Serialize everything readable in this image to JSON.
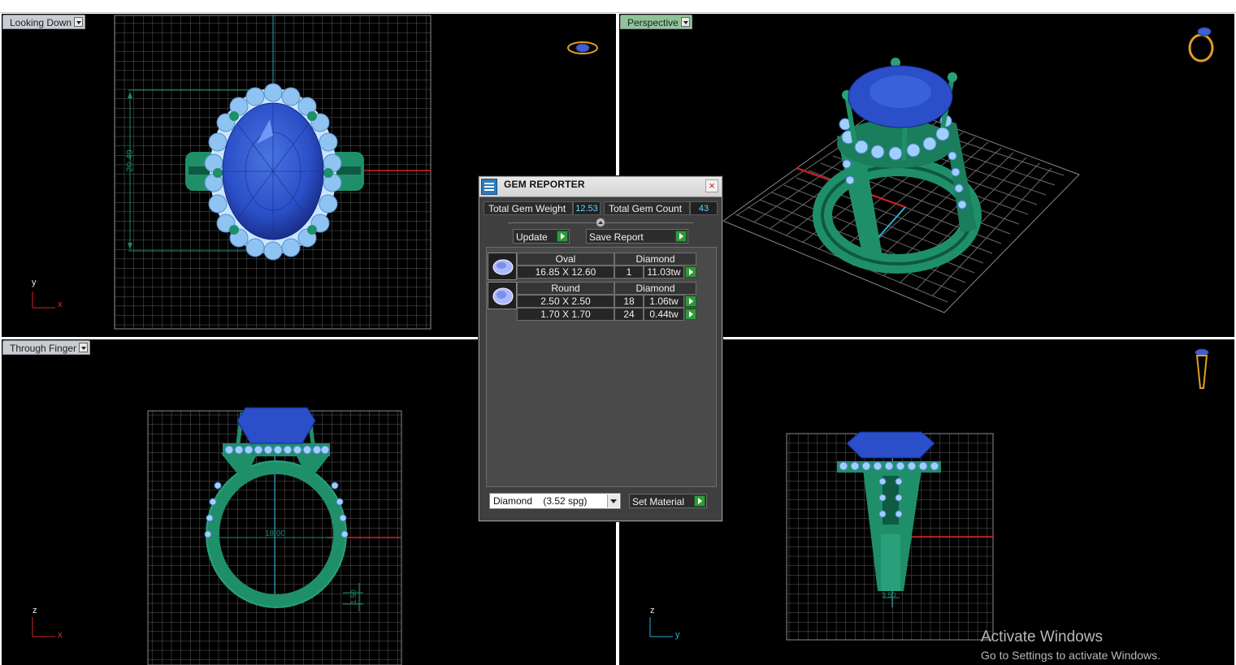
{
  "viewports": {
    "top_left": {
      "label": "Looking Down",
      "dimension": "20.49",
      "axis_v": "y",
      "axis_h": "x"
    },
    "top_right": {
      "label": "Perspective"
    },
    "bottom_left": {
      "label": "Through Finger",
      "dimension": "18.00",
      "dimension2": "1.50",
      "axis_v": "z",
      "axis_h": "x"
    },
    "bottom_right": {
      "dimension": "3.50",
      "axis_v": "z",
      "axis_h": "y"
    }
  },
  "gem_reporter": {
    "title": "GEM REPORTER",
    "close": "×",
    "total_weight_label": "Total Gem Weight",
    "total_weight_value": "12.53",
    "total_count_label": "Total Gem Count",
    "total_count_value": "43",
    "update_label": "Update",
    "save_report_label": "Save Report",
    "groups": [
      {
        "shape": "Oval",
        "material": "Diamond",
        "rows": [
          {
            "size": "16.85 X 12.60",
            "count": "1",
            "weight": "11.03tw"
          }
        ]
      },
      {
        "shape": "Round",
        "material": "Diamond",
        "rows": [
          {
            "size": "2.50 X 2.50",
            "count": "18",
            "weight": "1.06tw"
          },
          {
            "size": "1.70 X 1.70",
            "count": "24",
            "weight": "0.44tw"
          }
        ]
      }
    ],
    "material_select_value": "Diamond    (3.52 spg)",
    "set_material_label": "Set Material"
  },
  "watermark": {
    "title": "Activate Windows",
    "subtitle": "Go to Settings to activate Windows."
  },
  "colors": {
    "metal": "#1f8f6a",
    "metal_light": "#3bd1a3",
    "center_stone": "#2a4fc8",
    "accent_stones": "#9ecfff",
    "grid": "#6b6b6b",
    "x_axis": "#d82020",
    "y_axis": "#2ab0d8"
  },
  "icons": {
    "view_icons": [
      "ring-top-view-icon",
      "ring-perspective-icon",
      "ring-side-view-icon"
    ],
    "gem_icon": "oval-gem-icon"
  }
}
